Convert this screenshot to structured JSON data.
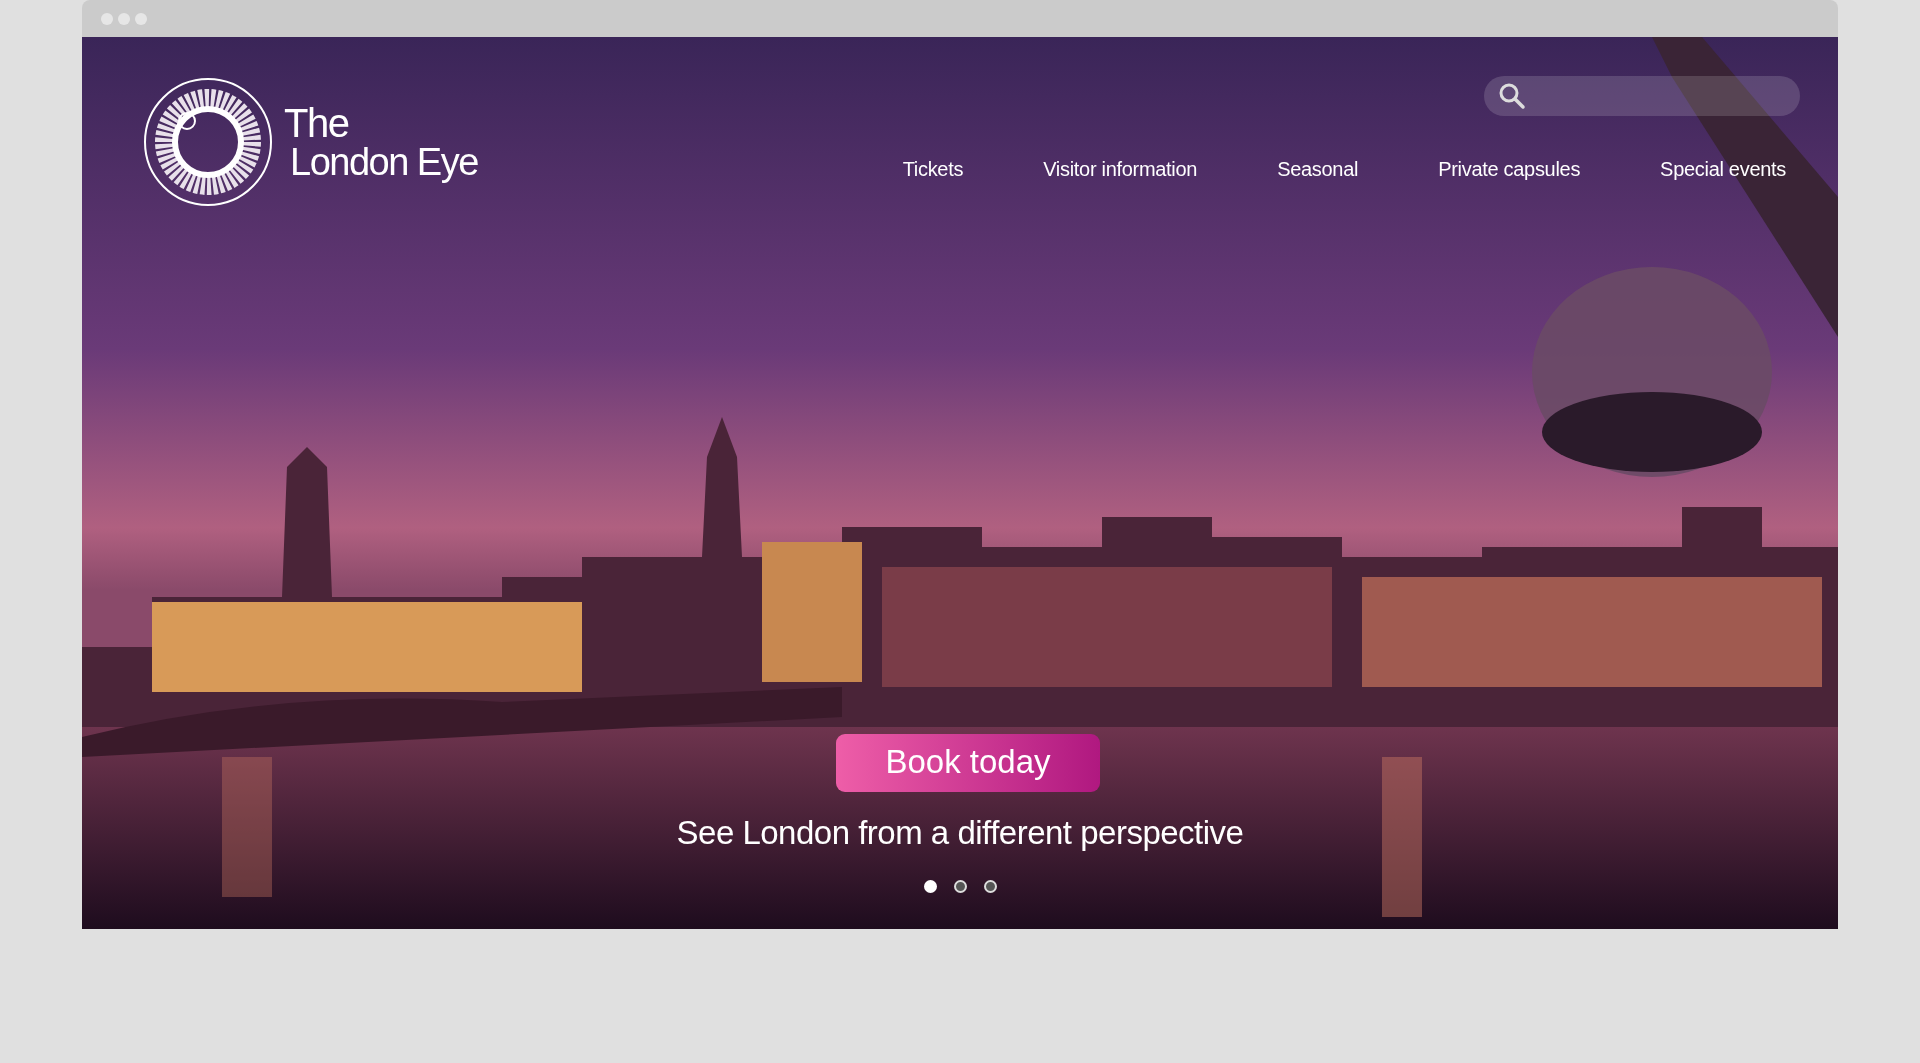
{
  "logo": {
    "line_1": "The",
    "line_2": "London Eye"
  },
  "nav": [
    {
      "label": "Tickets"
    },
    {
      "label": "Visitor information"
    },
    {
      "label": "Seasonal"
    },
    {
      "label": "Private capsules"
    },
    {
      "label": "Special events"
    }
  ],
  "hero": {
    "button": "Book today",
    "tagline": "See London from a different perspective",
    "slides": [
      {
        "selected": true
      },
      {
        "selected": false
      },
      {
        "selected": false
      }
    ]
  }
}
